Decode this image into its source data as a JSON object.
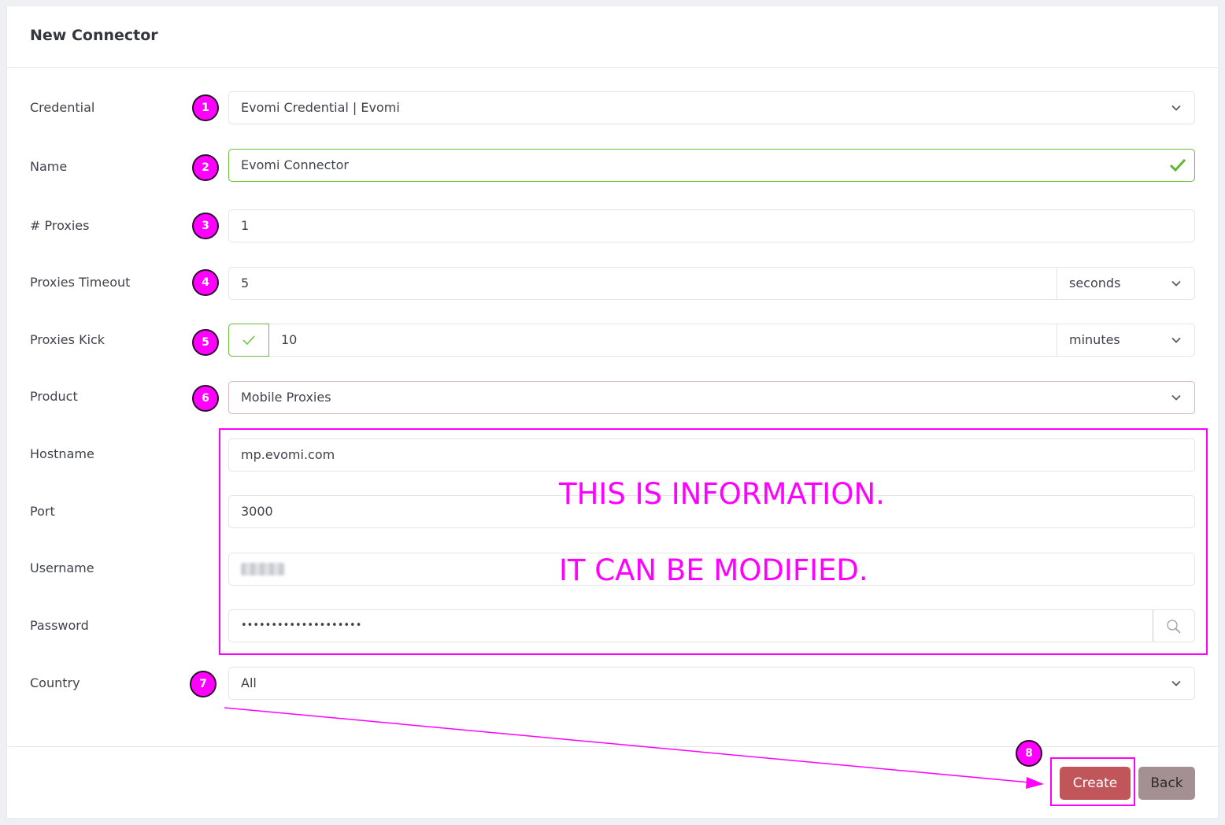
{
  "header": {
    "title": "New Connector"
  },
  "form": {
    "credential": {
      "label": "Credential",
      "value": "Evomi Credential | Evomi"
    },
    "name": {
      "label": "Name",
      "value": "Evomi Connector"
    },
    "proxies": {
      "label": "# Proxies",
      "value": "1"
    },
    "timeout": {
      "label": "Proxies Timeout",
      "value": "5",
      "unit": "seconds"
    },
    "kick": {
      "label": "Proxies Kick",
      "enabled": true,
      "value": "10",
      "unit": "minutes"
    },
    "product": {
      "label": "Product",
      "value": "Mobile Proxies"
    },
    "hostname": {
      "label": "Hostname",
      "value": "mp.evomi.com"
    },
    "port": {
      "label": "Port",
      "value": "3000"
    },
    "username": {
      "label": "Username"
    },
    "password": {
      "label": "Password",
      "value": "••••••••••••••••••••"
    },
    "country": {
      "label": "Country",
      "value": "All"
    }
  },
  "annotations": {
    "badges": [
      "1",
      "2",
      "3",
      "4",
      "5",
      "6",
      "7",
      "8"
    ],
    "note_line1": "THIS IS INFORMATION.",
    "note_line2": "IT CAN BE MODIFIED."
  },
  "footer": {
    "create_label": "Create",
    "back_label": "Back"
  },
  "colors": {
    "annotation": "#ff00ff",
    "valid": "#6cbf3a",
    "create": "#c0565a",
    "back": "#a48f92"
  },
  "icons": [
    "chevron-down-icon",
    "check-icon",
    "search-icon",
    "arrow-icon"
  ]
}
